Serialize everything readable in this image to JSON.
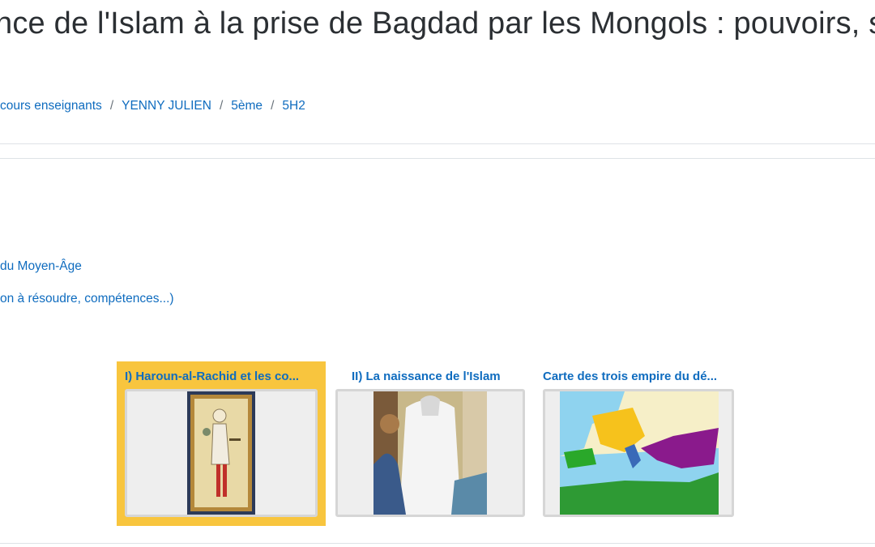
{
  "header": {
    "title": "nce de l'Islam à la prise de Bagdad par les Mongols : pouvoirs, s"
  },
  "breadcrumb": [
    {
      "label": "cours enseignants"
    },
    {
      "label": "YENNY JULIEN"
    },
    {
      "label": "5ème"
    },
    {
      "label": "5H2"
    }
  ],
  "breadcrumb_separator": "/",
  "links": {
    "line1": "du Moyen-Âge",
    "line2": "on à résoudre, compétences...)"
  },
  "cards": [
    {
      "title": "I) Haroun-al-Rachid et les co...",
      "image": "miniature-portrait-image",
      "selected": true
    },
    {
      "title": "II) La naissance de l'Islam",
      "image": "prophet-painting-image",
      "selected": false
    },
    {
      "title": "Carte des trois empire du dé...",
      "image": "three-empires-map-image",
      "selected": false
    }
  ],
  "colors": {
    "link": "#0f6cbf",
    "selected_card": "#f8c53e",
    "rule": "#dee2e6"
  }
}
